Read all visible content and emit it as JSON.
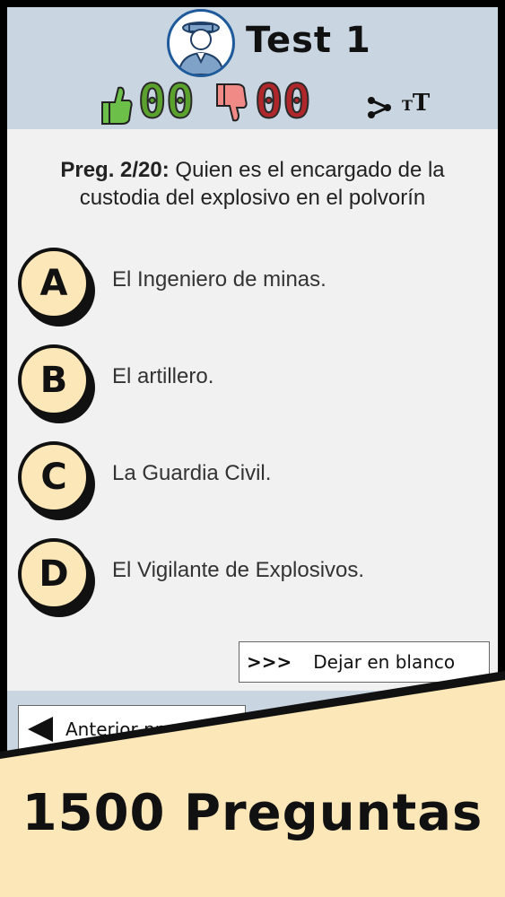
{
  "header": {
    "title": "Test 1",
    "correct_count": "00",
    "wrong_count": "00",
    "icons": {
      "avatar": "guard-avatar-icon",
      "correct": "thumbs-up-icon",
      "wrong": "thumbs-down-icon",
      "share": "share-icon",
      "font_size": "font-size-icon"
    },
    "font_icon_small": "T",
    "font_icon_big": "T",
    "colors": {
      "correct": "#5aa12e",
      "wrong": "#b0272b",
      "header_bg": "#c9d6e2"
    }
  },
  "question": {
    "number_label": "Preg. 2/20:",
    "text": "Quien es el encargado de la custodia del explosivo en el polvorín"
  },
  "answers": [
    {
      "letter": "A",
      "text": "El Ingeniero de minas."
    },
    {
      "letter": "B",
      "text": "El artillero."
    },
    {
      "letter": "C",
      "text": "La Guardia Civil."
    },
    {
      "letter": "D",
      "text": "El Vigilante de Explosivos."
    }
  ],
  "buttons": {
    "skip_arrows": ">>>",
    "skip_label": "Dejar en blanco",
    "prev_label": "Anterior pregunta"
  },
  "banner": {
    "text": "1500 Preguntas",
    "color": "#fbe7b7"
  }
}
